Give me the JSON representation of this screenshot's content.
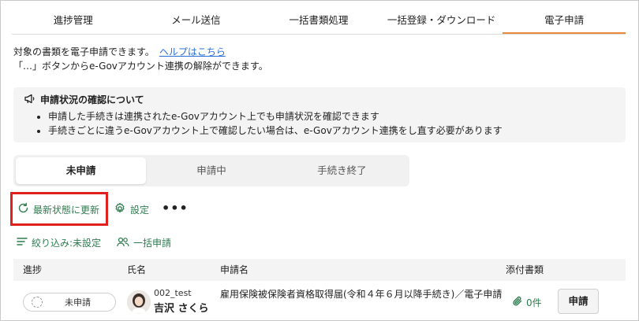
{
  "tabs": [
    "進捗管理",
    "メール送信",
    "一括書類処理",
    "一括登録・ダウンロード",
    "電子申請"
  ],
  "description": {
    "line1": "対象の書類を電子申請できます。",
    "help_link": "ヘルプはこちら",
    "line2": "「…」ボタンからe-Govアカウント連携の解除ができます。"
  },
  "notice": {
    "title": "申請状況の確認について",
    "items": [
      "申請した手続きは連携されたe-Govアカウント上でも申請状況を確認できます",
      "手続きごとに違うe-Govアカウント上で確認したい場合は、e-Govアカウント連携をし直す必要があります"
    ]
  },
  "segments": [
    "未申請",
    "申請中",
    "手続き終了"
  ],
  "actions": {
    "refresh": "最新状態に更新",
    "settings": "設定",
    "more": "•••",
    "filter": "絞り込み:未設定",
    "bulk_apply": "一括申請"
  },
  "table": {
    "headers": [
      "進捗",
      "氏名",
      "申請名",
      "添付書類"
    ],
    "rows": [
      {
        "status": "未申請",
        "user_id": "002_test",
        "user_name": "吉沢 さくら",
        "application": "雇用保険被保険者資格取得届(令和４年６月以降手続き)／電子申請",
        "attachments": "0件",
        "apply_button": "申請"
      }
    ]
  },
  "colors": {
    "accent_tab": "#e98a3a",
    "action_green": "#2e7d4f",
    "link_blue": "#2a6fd6",
    "highlight_red": "#e0201c"
  }
}
